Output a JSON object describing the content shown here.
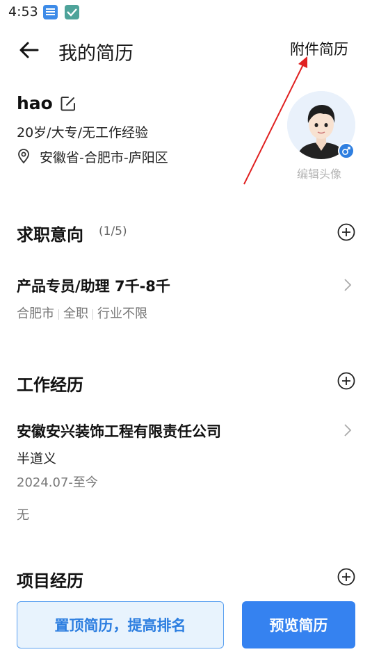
{
  "status_bar": {
    "time": "4:53"
  },
  "header": {
    "title": "我的简历",
    "attachment_link": "附件简历"
  },
  "profile": {
    "name": "hao",
    "basic_info": "20岁/大专/无工作经验",
    "location": "安徽省-合肥市-庐阳区",
    "avatar_edit_label": "编辑头像",
    "gender_symbol": "♂"
  },
  "job_intention": {
    "title": "求职意向",
    "count": "(1/5)",
    "item": {
      "title": "产品专员/助理 7千-8千",
      "tags": [
        "合肥市",
        "全职",
        "行业不限"
      ]
    }
  },
  "work_experience": {
    "title": "工作经历",
    "item": {
      "company": "安徽安兴装饰工程有限责任公司",
      "position": "半道义",
      "period": "2024.07-至今",
      "description": "无"
    }
  },
  "project_experience": {
    "title": "项目经历"
  },
  "actions": {
    "pin_resume": "置顶简历，提高排名",
    "preview_resume": "预览简历"
  },
  "colors": {
    "accent": "#3582f0",
    "annotation_arrow": "#e02020"
  }
}
